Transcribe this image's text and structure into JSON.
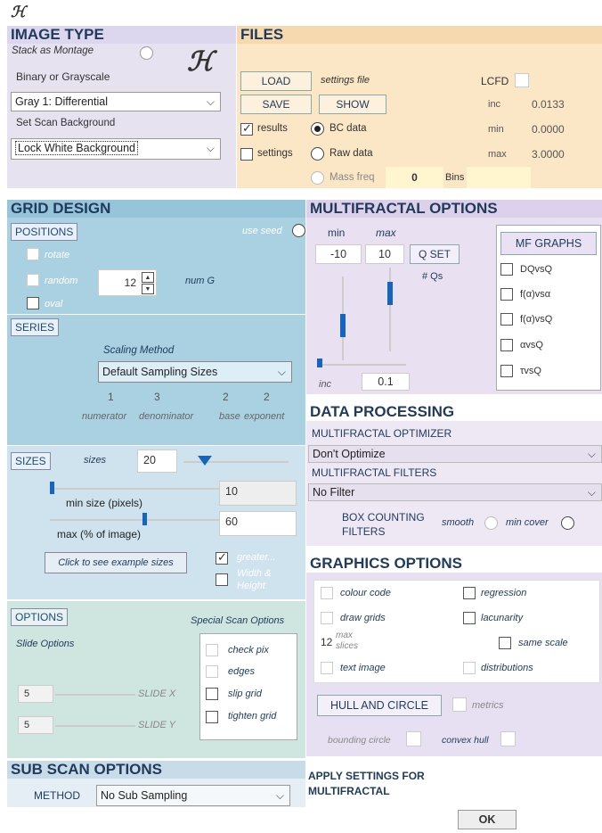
{
  "app": {
    "logo": "ℋ"
  },
  "image_type": {
    "title": "IMAGE TYPE",
    "stack_label": "Stack as Montage",
    "binary_label": "Binary or Grayscale",
    "gray_select": "Gray 1: Differential",
    "scan_bg_label": "Set Scan Background",
    "bg_select": "Lock White Background"
  },
  "files": {
    "title": "FILES",
    "load": "LOAD",
    "settings_file": "settings file",
    "lcfd": "LCFD",
    "save": "SAVE",
    "show": "SHOW",
    "inc_label": "inc",
    "inc_value": "0.0133",
    "results": "results",
    "bc_data": "BC data",
    "min_label": "min",
    "min_value": "0.0000",
    "settings": "settings",
    "raw_data": "Raw data",
    "max_label": "max",
    "max_value": "3.0000",
    "mass_freq": "Mass freq",
    "bins_value": "0",
    "bins_label": "Bins"
  },
  "grid": {
    "title": "GRID DESIGN",
    "positions": "POSITIONS",
    "use_seed": "use seed",
    "rotate": "rotate",
    "random": "random",
    "num_value": "12",
    "num_label": "num G",
    "oval": "oval",
    "series": "SERIES",
    "scaling_method": "Scaling Method",
    "sampling_select": "Default Sampling Sizes",
    "n1": "1",
    "n2": "3",
    "n3": "2",
    "n4": "2",
    "numerator": "numerator",
    "denominator": "denominator",
    "base": "base",
    "exponent": "exponent",
    "sizes": "SIZES",
    "sizes_label": "sizes",
    "sizes_value": "20",
    "min_size_label": "min size (pixels)",
    "min_size_value": "10",
    "max_size_label": "max (% of image)",
    "max_size_value": "60",
    "example_btn": "Click to see example sizes",
    "greater": "greater...",
    "width_height": "Width & Height",
    "options": "OPTIONS",
    "special_scan": "Special Scan Options",
    "slide_options": "Slide Options",
    "check_pix": "check pix",
    "edges": "edges",
    "slide_x_value": "5",
    "slide_x": "SLIDE X",
    "slip_grid": "slip grid",
    "slide_y_value": "5",
    "slide_y": "SLIDE Y",
    "tighten_grid": "tighten grid"
  },
  "subscan": {
    "title": "SUB SCAN OPTIONS",
    "method": "METHOD",
    "method_select": "No Sub Sampling"
  },
  "mf": {
    "title": "MULTIFRACTAL OPTIONS",
    "min": "min",
    "max": "max",
    "min_value": "-10",
    "max_value": "10",
    "qset": "Q SET",
    "qs": "# Qs",
    "inc": "inc",
    "inc_value": "0.1",
    "mf_graphs": "MF GRAPHS",
    "g1": "DQvsQ",
    "g2": "f(α)vsα",
    "g3": "f(α)vsQ",
    "g4": "αvsQ",
    "g5": "τvsQ"
  },
  "dp": {
    "title": "DATA PROCESSING",
    "optimizer": "MULTIFRACTAL OPTIMIZER",
    "optimizer_select": "Don't Optimize",
    "filters": "MULTIFRACTAL FILTERS",
    "filter_select": "No Filter",
    "box_counting": "BOX COUNTING FILTERS",
    "smooth": "smooth",
    "min_cover": "min cover"
  },
  "go": {
    "title": "GRAPHICS OPTIONS",
    "colour_code": "colour code",
    "regression": "regression",
    "draw_grids": "draw grids",
    "lacunarity": "lacunarity",
    "max_value": "12",
    "max_slices": "max slices",
    "same_scale": "same scale",
    "text_image": "text image",
    "distributions": "distributions",
    "hull_btn": "HULL AND CIRCLE",
    "metrics": "metrics",
    "bounding_circle": "bounding circle",
    "convex_hull": "convex hull"
  },
  "apply": {
    "text": "APPLY SETTINGS FOR MULTIFRACTAL",
    "ok": "OK"
  },
  "colors": {
    "lavender": "#e6e0f2",
    "peach": "#fbe4c3",
    "blue": "#a9d1e2",
    "lightblue": "#cfe3ee",
    "green": "#cfe5df",
    "purple": "#dcd0ea"
  }
}
